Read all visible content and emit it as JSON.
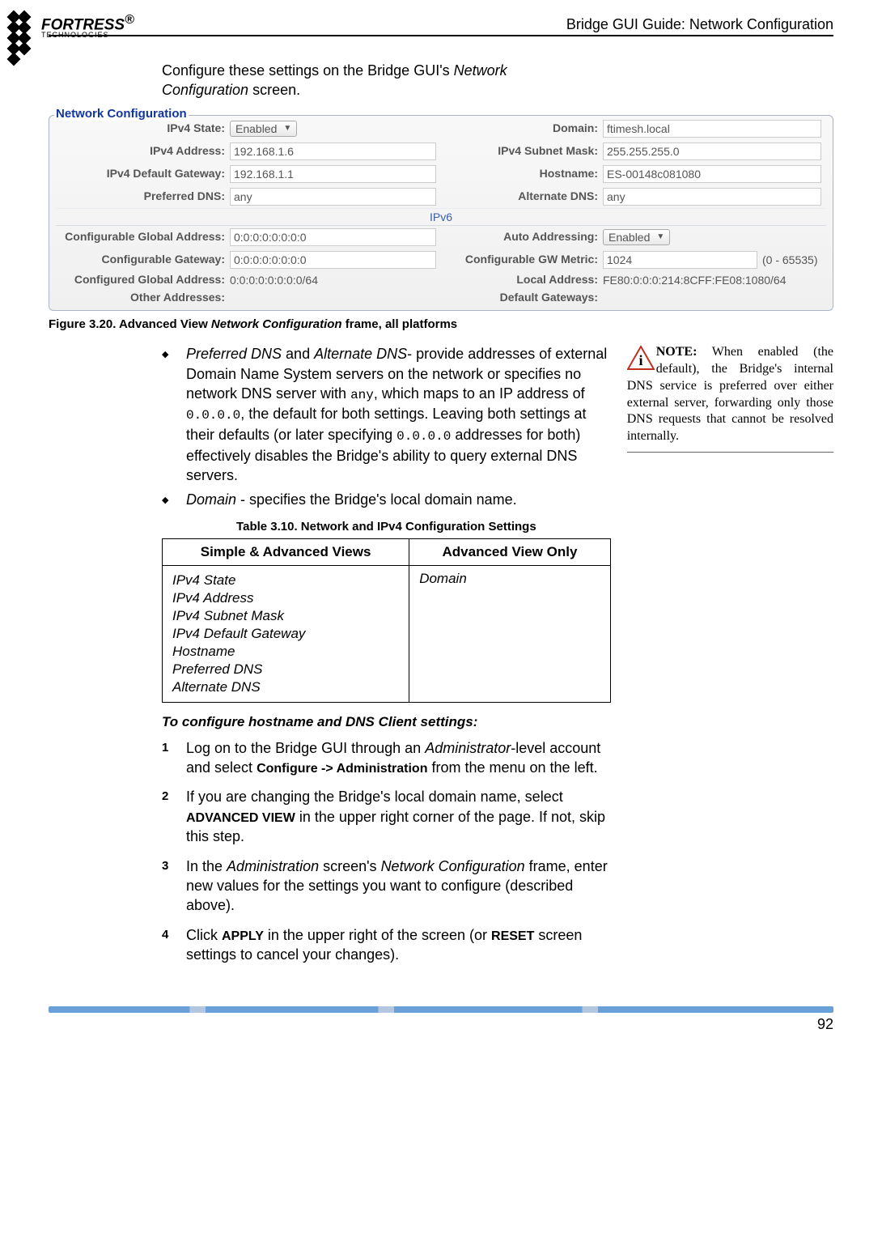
{
  "header": {
    "running_head": "Bridge GUI Guide: Network Configuration"
  },
  "logo": {
    "line1": "FORTRESS",
    "reg": "®",
    "line2": "TECHNOLOGIES"
  },
  "intro": {
    "para1_a": "Configure these settings on the Bridge GUI's ",
    "para1_b": "Network Configuration",
    "para1_c": " screen."
  },
  "figure": {
    "legend": "Network Configuration",
    "ipv4": {
      "state_label": "IPv4 State:",
      "state_val": "Enabled",
      "domain_label": "Domain:",
      "domain_val": "ftimesh.local",
      "addr_label": "IPv4 Address:",
      "addr_val": "192.168.1.6",
      "mask_label": "IPv4 Subnet Mask:",
      "mask_val": "255.255.255.0",
      "gw_label": "IPv4 Default Gateway:",
      "gw_val": "192.168.1.1",
      "host_label": "Hostname:",
      "host_val": "ES-00148c081080",
      "pdns_label": "Preferred DNS:",
      "pdns_val": "any",
      "adns_label": "Alternate DNS:",
      "adns_val": "any"
    },
    "ipv6_sep": "IPv6",
    "ipv6": {
      "cga_label": "Configurable Global Address:",
      "cga_val": "0:0:0:0:0:0:0:0",
      "auto_label": "Auto Addressing:",
      "auto_val": "Enabled",
      "cgw_label": "Configurable Gateway:",
      "cgw_val": "0:0:0:0:0:0:0:0",
      "metric_label": "Configurable GW Metric:",
      "metric_val": "1024",
      "metric_hint": "(0 - 65535)",
      "configd_label": "Configured Global Address:",
      "configd_val": "0:0:0:0:0:0:0:0/64",
      "local_label": "Local Address:",
      "local_val": "FE80:0:0:0:214:8CFF:FE08:1080/64",
      "other_label": "Other Addresses:",
      "dgw_label": "Default Gateways:"
    },
    "caption_a": "Figure 3.20. Advanced View ",
    "caption_b": "Network Configuration",
    "caption_c": " frame, all platforms"
  },
  "bullets": {
    "b1_a": "Preferred DNS",
    "b1_b": " and ",
    "b1_c": "Alternate DNS",
    "b1_d": "- provide addresses of external Domain Name System servers on the network or specifies no network DNS server with ",
    "b1_e": "any",
    "b1_f": ", which maps to an IP address of ",
    "b1_g": "0.0.0.0",
    "b1_h": ", the default for both settings. Leaving both settings at their defaults (or later specifying ",
    "b1_i": "0.0.0.0",
    "b1_j": " addresses for both) effectively disables the Bridge's ability to query external DNS servers.",
    "b2_a": "Domain",
    "b2_b": " - specifies the Bridge's local domain name."
  },
  "table": {
    "title": "Table 3.10. Network and IPv4 Configuration Settings",
    "h1": "Simple & Advanced Views",
    "h2": "Advanced View Only",
    "col1": [
      "IPv4 State",
      "IPv4 Address",
      "IPv4 Subnet Mask",
      "IPv4 Default Gateway",
      "Hostname",
      "Preferred DNS",
      "Alternate DNS"
    ],
    "col2": "Domain"
  },
  "procedure": {
    "title": "To configure hostname and DNS Client settings:",
    "steps": [
      {
        "n": "1",
        "segs": [
          "Log on to the Bridge GUI through an ",
          {
            "i": "Administrator"
          },
          "-level account and select ",
          {
            "b": "Configure -> Administration"
          },
          " from the menu on the left."
        ]
      },
      {
        "n": "2",
        "segs": [
          "If you are changing the Bridge's local domain name, select ",
          {
            "sc": "ADVANCED VIEW"
          },
          " in the upper right corner of the page. If not, skip this step."
        ]
      },
      {
        "n": "3",
        "segs": [
          "In the ",
          {
            "i": "Administration"
          },
          " screen's ",
          {
            "i": "Network Configuration"
          },
          " frame, enter new values for the settings you want to configure (described above)."
        ]
      },
      {
        "n": "4",
        "segs": [
          "Click ",
          {
            "sc": "APPLY"
          },
          " in the upper right of the screen (or ",
          {
            "sc": "RESET"
          },
          " screen settings to cancel your changes)."
        ]
      }
    ]
  },
  "note": {
    "lead": "NOTE:",
    "body": " When enabled (the default), the Bridge's internal DNS service is preferred over either external server, forwarding only those DNS requests that cannot be resolved internally."
  },
  "page_number": "92"
}
